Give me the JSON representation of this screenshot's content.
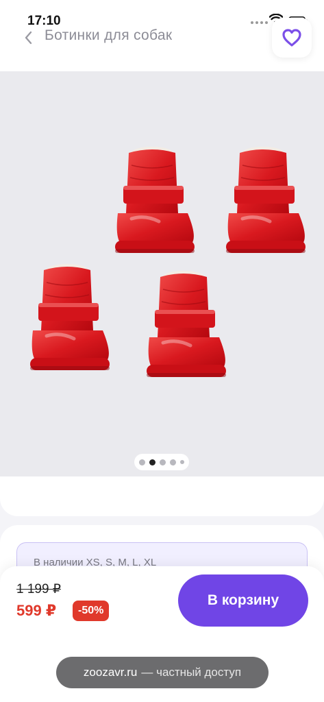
{
  "status_bar": {
    "time": "17:10",
    "icons": [
      "signal-dots-icon",
      "wifi-icon",
      "battery-icon"
    ]
  },
  "header": {
    "back_icon": "chevron-left-icon",
    "title": "Ботинки для собак",
    "favorite_icon": "heart-icon"
  },
  "gallery": {
    "image": "red-dog-boots-photo",
    "page_count": 5,
    "active_page": 2
  },
  "availability": {
    "text": "В наличии XS, S, M, L, XL"
  },
  "purchase": {
    "old_price": "1 199 ₽",
    "new_price": "599 ₽",
    "discount": "-50%",
    "cart_button": "В корзину"
  },
  "browser": {
    "host": "zoozavr.ru",
    "suffix": "— частный доступ"
  },
  "colors": {
    "accent": "#7045e6",
    "price_red": "#e0392b",
    "boot_red": "#e0282b"
  }
}
